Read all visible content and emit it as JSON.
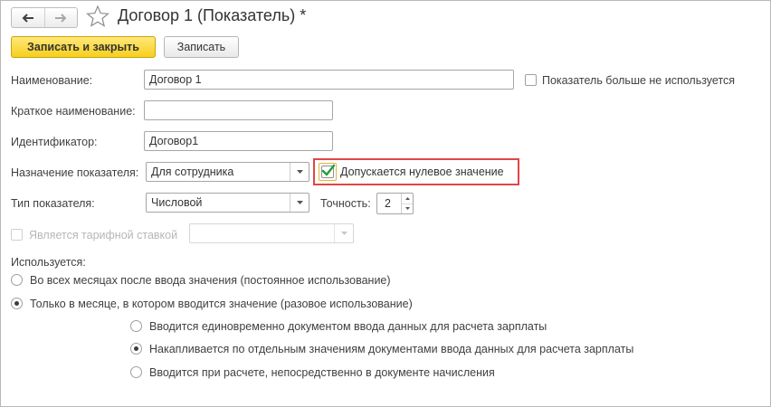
{
  "header": {
    "title": "Договор 1 (Показатель) *",
    "back_icon": "arrow-left-icon",
    "forward_icon": "arrow-right-icon",
    "favorite_icon": "star-icon"
  },
  "toolbar": {
    "save_close_label": "Записать и закрыть",
    "save_label": "Записать"
  },
  "form": {
    "name_label": "Наименование:",
    "name_value": "Договор 1",
    "unused_label": "Показатель больше не используется",
    "short_name_label": "Краткое наименование:",
    "short_name_value": "",
    "identifier_label": "Идентификатор:",
    "identifier_value": "Договор1",
    "purpose_label": "Назначение показателя:",
    "purpose_value": "Для сотрудника",
    "zero_allowed_label": "Допускается нулевое значение",
    "type_label": "Тип показателя:",
    "type_value": "Числовой",
    "precision_label": "Точность:",
    "precision_value": "2",
    "tariff_label": "Является тарифной ставкой",
    "tariff_value": ""
  },
  "usage": {
    "label": "Используется:",
    "options": [
      "Во всех месяцах после ввода значения (постоянное использование)",
      "Только в месяце, в котором вводится значение (разовое использование)"
    ],
    "sub_options": [
      "Вводится единовременно документом ввода данных для расчета зарплаты",
      "Накапливается по отдельным значениям документами ввода данных для расчета зарплаты",
      "Вводится при расчете, непосредственно в документе начисления"
    ]
  },
  "colors": {
    "primary_button": "#f6cf1c",
    "highlight_border": "#e04646",
    "check_mark": "#1e9e3a"
  }
}
